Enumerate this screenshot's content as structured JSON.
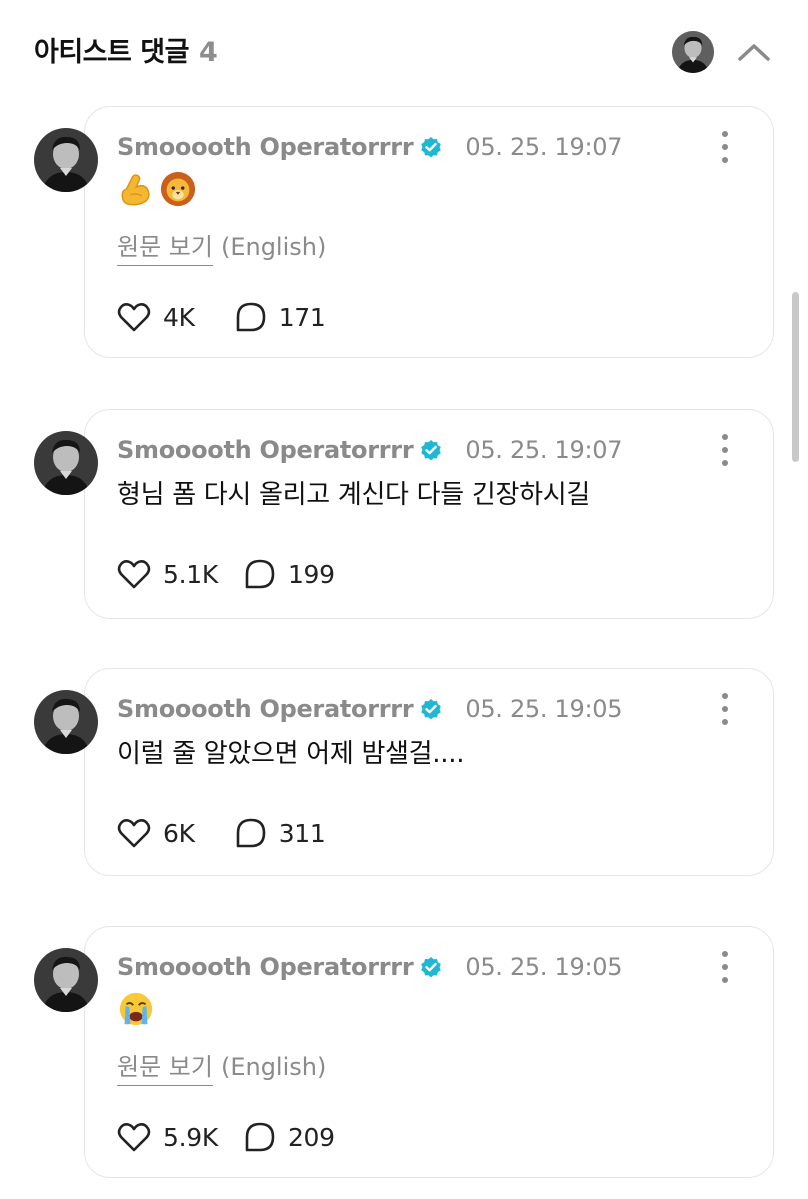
{
  "header": {
    "title": "아티스트 댓글",
    "count": "4",
    "avatar_icon": "artist-avatar-icon",
    "collapse_icon": "chevron-up-icon"
  },
  "comments": [
    {
      "author": "Smooooth Operatorrrr",
      "timestamp": "05. 25. 19:07",
      "emojis": [
        "💪",
        "🦁"
      ],
      "translate_link": "원문 보기",
      "translate_lang": "(English)",
      "likes": "4K",
      "replies": "171"
    },
    {
      "author": "Smooooth Operatorrrr",
      "timestamp": "05. 25. 19:07",
      "text": "형님 폼 다시 올리고 계신다 다들 긴장하시길",
      "likes": "5.1K",
      "replies": "199"
    },
    {
      "author": "Smooooth Operatorrrr",
      "timestamp": "05. 25. 19:05",
      "text": "이럴 줄 알았으면 어제 밤샐걸....",
      "likes": "6K",
      "replies": "311"
    },
    {
      "author": "Smooooth Operatorrrr",
      "timestamp": "05. 25. 19:05",
      "emojis": [
        "😭"
      ],
      "translate_link": "원문 보기",
      "translate_lang": "(English)",
      "likes": "5.9K",
      "replies": "209"
    }
  ],
  "icons": {
    "verified": "verified-badge-icon",
    "like": "heart-icon",
    "reply": "comment-bubble-icon",
    "more": "more-vertical-icon"
  },
  "colors": {
    "verified": "#1fb8d2",
    "muted_text": "#8a8a8a",
    "card_border": "#e6e6e6"
  }
}
